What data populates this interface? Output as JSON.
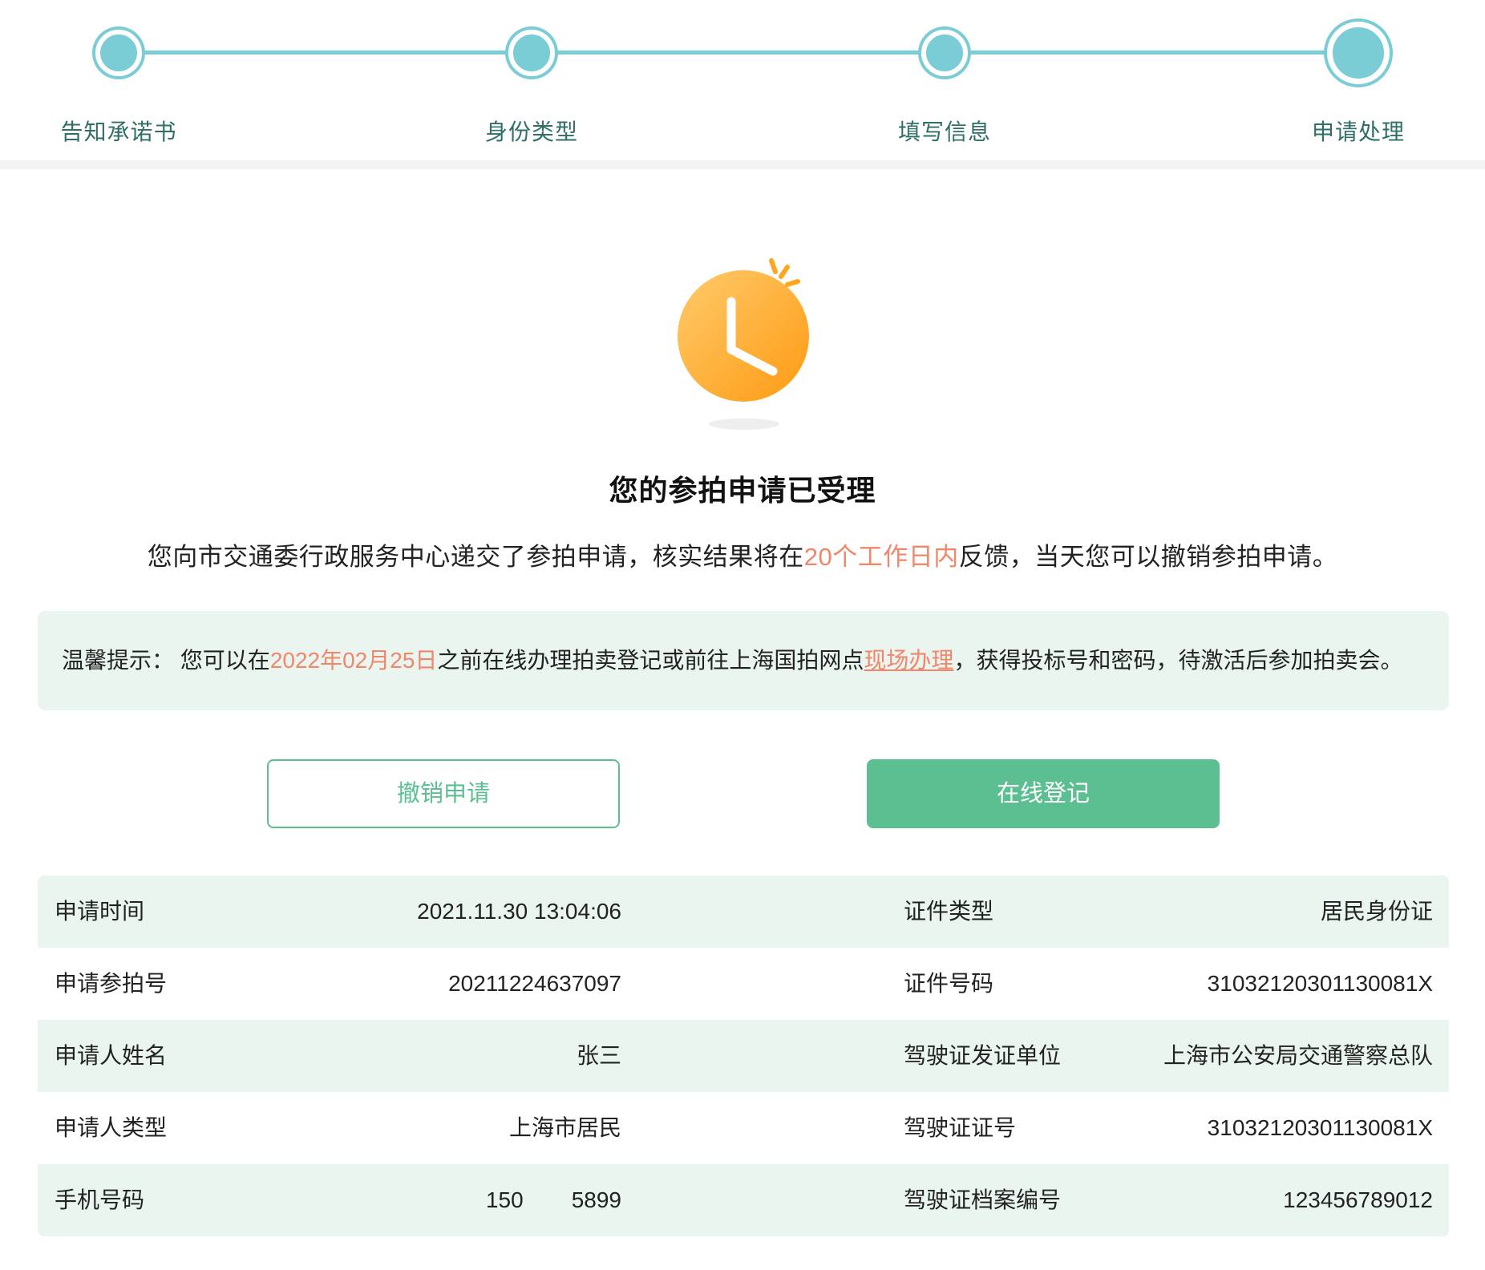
{
  "steps": [
    {
      "label": "告知承诺书"
    },
    {
      "label": "身份类型"
    },
    {
      "label": "填写信息"
    },
    {
      "label": "申请处理"
    }
  ],
  "result": {
    "title": "您的参拍申请已受理",
    "desc_before": "您向市交通委行政服务中心递交了参拍申请，核实结果将在",
    "desc_highlight": "20个工作日内",
    "desc_after": "反馈，当天您可以撤销参拍申请。"
  },
  "tip": {
    "prefix": "温馨提示：",
    "part1": "您可以在",
    "date": "2022年02月25日",
    "part2": "之前在线办理拍卖登记或前往上海国拍网点",
    "link": "现场办理",
    "part3": "，获得投标号和密码，待激活后参加拍卖会。"
  },
  "buttons": {
    "cancel_label": "撤销申请",
    "register_label": "在线登记"
  },
  "info": {
    "rows": [
      {
        "label_left": "申请时间",
        "value_left": "2021.11.30 13:04:06",
        "label_right": "证件类型",
        "value_right": "居民身份证"
      },
      {
        "label_left": "申请参拍号",
        "value_left": "20211224637097",
        "label_right": "证件号码",
        "value_right": "31032120301130081X"
      },
      {
        "label_left": "申请人姓名",
        "value_left": "张三",
        "label_right": "驾驶证发证单位",
        "value_right": "上海市公安局交通警察总队"
      },
      {
        "label_left": "申请人类型",
        "value_left": "上海市居民",
        "label_right": "驾驶证证号",
        "value_right": "31032120301130081X"
      },
      {
        "label_left": "手机号码",
        "value_left_a": "150",
        "value_left_b": "5899",
        "label_right": "驾驶证档案编号",
        "value_right": "123456789012"
      }
    ]
  },
  "colors": {
    "accent": "#5cbf92",
    "step": "#7bcdd5",
    "highlight": "#f0876a",
    "row_shade": "#eaf5ef"
  }
}
